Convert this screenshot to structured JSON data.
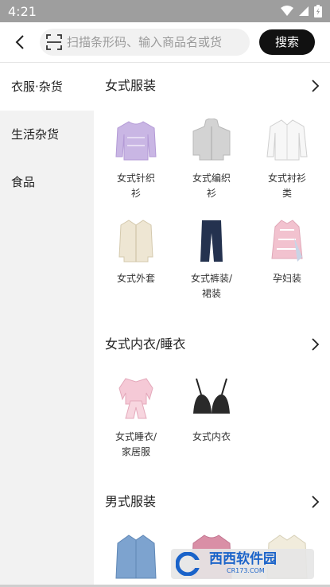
{
  "status_bar": {
    "time": "4:21"
  },
  "header": {
    "search_placeholder": "扫描条形码、输入商品名或货",
    "search_button": "搜索"
  },
  "sidebar": {
    "items": [
      {
        "label": "衣服·杂货"
      },
      {
        "label": "生活杂货"
      },
      {
        "label": "食品"
      }
    ]
  },
  "sections": [
    {
      "title": "女式服装",
      "items": [
        {
          "line1": "女式针织",
          "line2": "衫",
          "icon": "sweater-lilac-icon"
        },
        {
          "line1": "女式编织",
          "line2": "衫",
          "icon": "hoodie-grey-icon"
        },
        {
          "line1": "女式衬衫",
          "line2": "类",
          "icon": "shirt-white-icon"
        },
        {
          "line1": "女式外套",
          "line2": "",
          "icon": "coat-beige-icon"
        },
        {
          "line1": "女式裤装/",
          "line2": "裙装",
          "icon": "trousers-navy-icon"
        },
        {
          "line1": "孕妇装",
          "line2": "",
          "icon": "maternity-dress-icon"
        }
      ]
    },
    {
      "title": "女式内衣/睡衣",
      "items": [
        {
          "line1": "女式睡衣/",
          "line2": "家居服",
          "icon": "pajamas-pink-icon"
        },
        {
          "line1": "女式内衣",
          "line2": "",
          "icon": "bra-black-icon"
        }
      ]
    },
    {
      "title": "男式服装",
      "items": [
        {
          "line1": "",
          "line2": "",
          "icon": "shirt-blue-icon"
        },
        {
          "line1": "",
          "line2": "",
          "icon": "sweater-pink-icon"
        },
        {
          "line1": "",
          "line2": "",
          "icon": "shirt-cream-icon"
        }
      ]
    }
  ],
  "watermark": {
    "name": "西西软件园",
    "url": "CR173.COM"
  },
  "colors": {
    "status_bar": "#9e9e9e",
    "accent_button": "#111111",
    "sidebar_bg": "#f2f2f2"
  }
}
